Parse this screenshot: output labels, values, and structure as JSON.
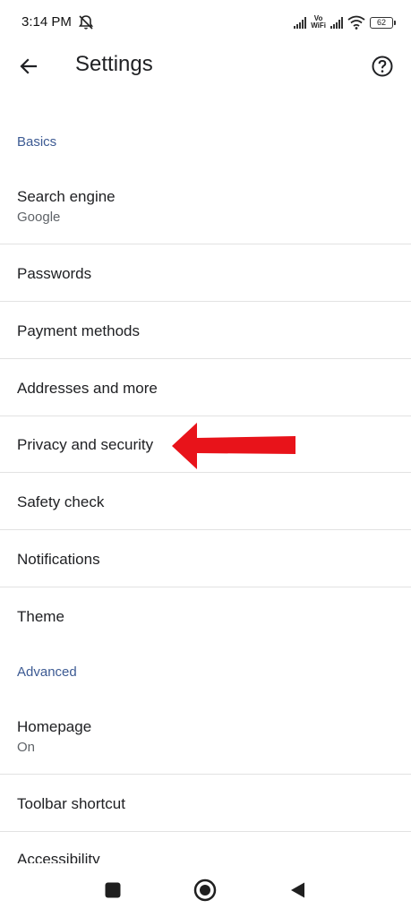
{
  "status_bar": {
    "time": "3:14 PM",
    "vo_wifi_top": "Vo",
    "vo_wifi_bottom": "WiFi",
    "battery": "62"
  },
  "app_bar": {
    "title": "Settings",
    "back_icon": "arrow-left-icon",
    "help_icon": "help-circle-icon"
  },
  "sections": {
    "basics": "Basics",
    "advanced": "Advanced"
  },
  "items": {
    "search_engine": {
      "title": "Search engine",
      "subtitle": "Google"
    },
    "passwords": {
      "title": "Passwords"
    },
    "payment_methods": {
      "title": "Payment methods"
    },
    "addresses": {
      "title": "Addresses and more"
    },
    "privacy": {
      "title": "Privacy and security"
    },
    "safety_check": {
      "title": "Safety check"
    },
    "notifications": {
      "title": "Notifications"
    },
    "theme": {
      "title": "Theme"
    },
    "homepage": {
      "title": "Homepage",
      "subtitle": "On"
    },
    "toolbar_shortcut": {
      "title": "Toolbar shortcut"
    },
    "accessibility": {
      "title": "Accessibility"
    }
  },
  "annotation": {
    "arrow_color": "#e8131a",
    "points_to": "Privacy and security"
  },
  "colors": {
    "section_header": "#3c5a93",
    "divider": "#e2e2e2"
  }
}
